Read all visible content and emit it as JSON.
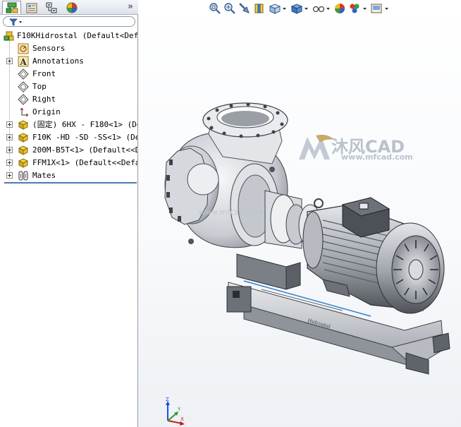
{
  "panel": {
    "tabs": [
      {
        "name": "FeatureManager Design Tree",
        "icon": "feature-tree-icon"
      },
      {
        "name": "PropertyManager",
        "icon": "property-manager-icon"
      },
      {
        "name": "ConfigurationManager",
        "icon": "configuration-manager-icon"
      },
      {
        "name": "DisplayManager",
        "icon": "display-manager-icon"
      }
    ],
    "expand_glyph": "»"
  },
  "tree": {
    "root": "F10KHidrostal  (Default<Defa",
    "items": [
      {
        "label": "Sensors",
        "icon": "sensors-icon",
        "expandable": false
      },
      {
        "label": "Annotations",
        "icon": "annotations-icon",
        "expandable": true
      },
      {
        "label": "Front",
        "icon": "plane-icon",
        "expandable": false
      },
      {
        "label": "Top",
        "icon": "plane-icon",
        "expandable": false
      },
      {
        "label": "Right",
        "icon": "plane-icon",
        "expandable": false
      },
      {
        "label": "Origin",
        "icon": "origin-icon",
        "expandable": false
      },
      {
        "label": "(固定) 6HX - F180<1> (De",
        "icon": "part-icon",
        "expandable": true
      },
      {
        "label": "F10K -HD -SD -SS<1> (Def",
        "icon": "part-icon",
        "expandable": true
      },
      {
        "label": "200M-B5T<1> (Default<<De",
        "icon": "part-icon",
        "expandable": true
      },
      {
        "label": "FFM1X<1> (Default<<Defau",
        "icon": "part-icon",
        "expandable": true
      },
      {
        "label": "Mates",
        "icon": "mates-icon",
        "expandable": true
      }
    ]
  },
  "toolbar": {
    "icons": [
      "zoom-to-fit-icon",
      "zoom-to-area-icon",
      "previous-view-icon",
      "section-view-icon",
      "view-orientation-icon",
      "display-style-icon",
      "hide-show-items-icon",
      "edit-appearance-icon",
      "apply-scene-icon",
      "view-settings-icon"
    ]
  },
  "watermark": {
    "brand": "沐风CAD",
    "url": "www.mfcad.com",
    "overlay": "www.mfcad.com"
  },
  "triad": {
    "x": "X",
    "y": "Y",
    "z": "Z"
  },
  "colors": {
    "accent": "#4a7ab8",
    "model_steel": "#c9ccd2",
    "model_dark": "#4d5157"
  }
}
